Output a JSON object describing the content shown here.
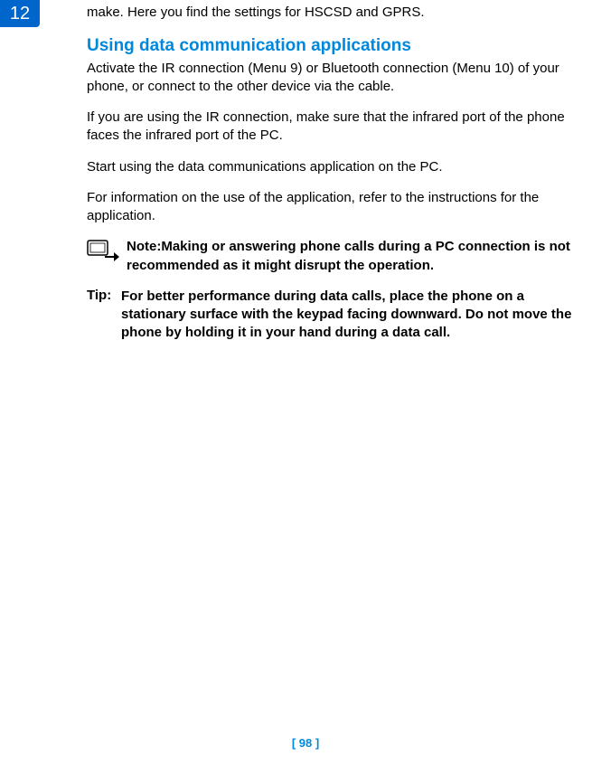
{
  "chapter_number": "12",
  "continuation_text": "make. Here you find the settings for HSCSD and GPRS.",
  "section_heading": "Using data communication applications",
  "paragraphs": {
    "p1": "Activate the IR connection (Menu 9) or Bluetooth connection (Menu 10) of your phone, or connect to the other device via the cable.",
    "p2": "If you are using the IR connection, make sure that the infrared port of the phone faces the infrared port of the PC.",
    "p3": "Start using the data communications application on the PC.",
    "p4": "For information on the use of the application, refer to the instructions for the application."
  },
  "note": {
    "label": "Note:",
    "text": "Making or answering phone calls during a PC connection is not recommended as it might disrupt the operation."
  },
  "tip": {
    "label": "Tip:",
    "text": "For better performance during data calls, place the phone on a stationary surface with the keypad facing downward. Do not move the phone by holding it in your hand during a data call."
  },
  "page_number": "[ 98 ]"
}
